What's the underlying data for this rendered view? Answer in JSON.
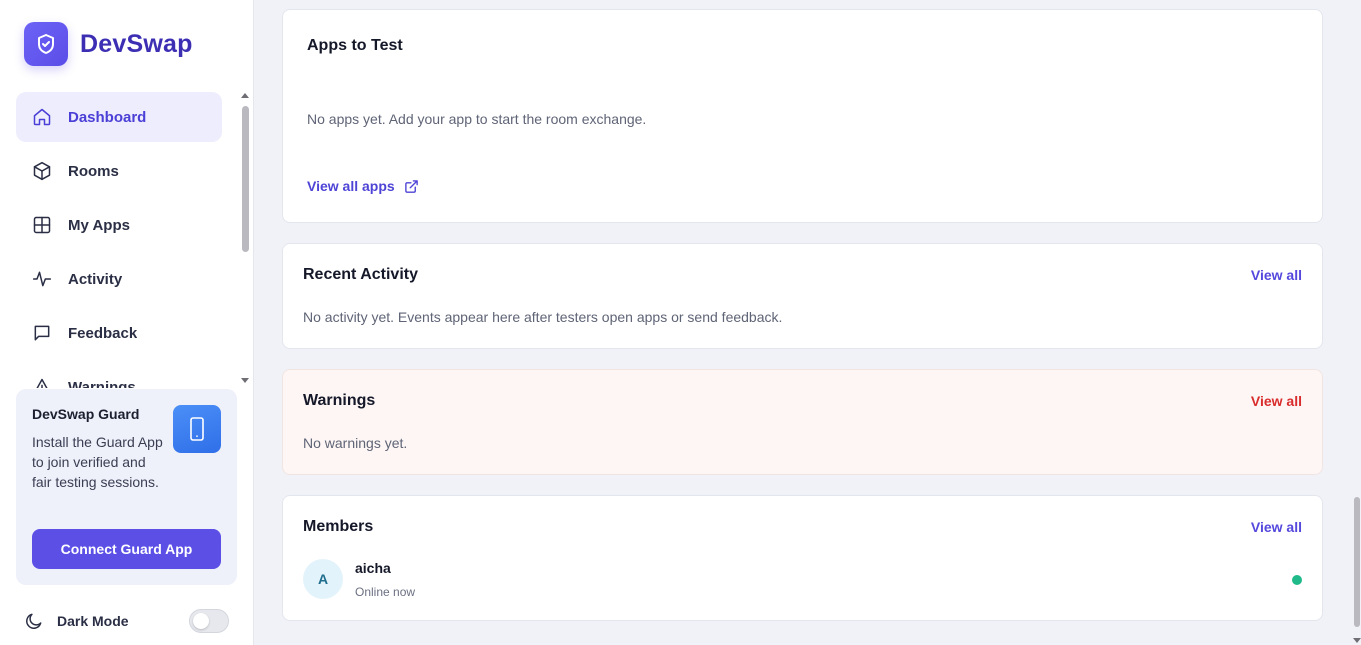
{
  "brand": {
    "name": "DevSwap",
    "logo_icon": "shield-check-icon",
    "accent": "#5b4fe6"
  },
  "sidebar": {
    "items": [
      {
        "label": "Dashboard",
        "icon": "home-icon",
        "active": true
      },
      {
        "label": "Rooms",
        "icon": "cube-icon",
        "active": false
      },
      {
        "label": "My Apps",
        "icon": "grid-icon",
        "active": false
      },
      {
        "label": "Activity",
        "icon": "activity-icon",
        "active": false
      },
      {
        "label": "Feedback",
        "icon": "message-square-icon",
        "active": false
      },
      {
        "label": "Warnings",
        "icon": "alert-triangle-icon",
        "active": false
      }
    ]
  },
  "guard": {
    "title": "DevSwap Guard",
    "text": "Install the Guard App to join verified and fair testing sessions.",
    "icon": "smartphone-icon",
    "button_label": "Connect Guard App"
  },
  "dark_mode": {
    "label": "Dark Mode",
    "icon": "moon-icon",
    "enabled": false
  },
  "apps_to_test": {
    "title": "Apps to Test",
    "empty_text": "No apps yet. Add your app to start the room exchange.",
    "link_label": "View all apps",
    "link_icon": "external-link-icon"
  },
  "recent_activity": {
    "title": "Recent Activity",
    "view_all": "View all",
    "empty_text": "No activity yet. Events appear here after testers open apps or send feedback."
  },
  "warnings": {
    "title": "Warnings",
    "view_all": "View all",
    "empty_text": "No warnings yet.",
    "accent": "#d92d2d"
  },
  "members": {
    "title": "Members",
    "view_all": "View all",
    "list": [
      {
        "initial": "A",
        "name": "aicha",
        "status": "Online now",
        "status_color": "#1fb98a"
      }
    ]
  }
}
